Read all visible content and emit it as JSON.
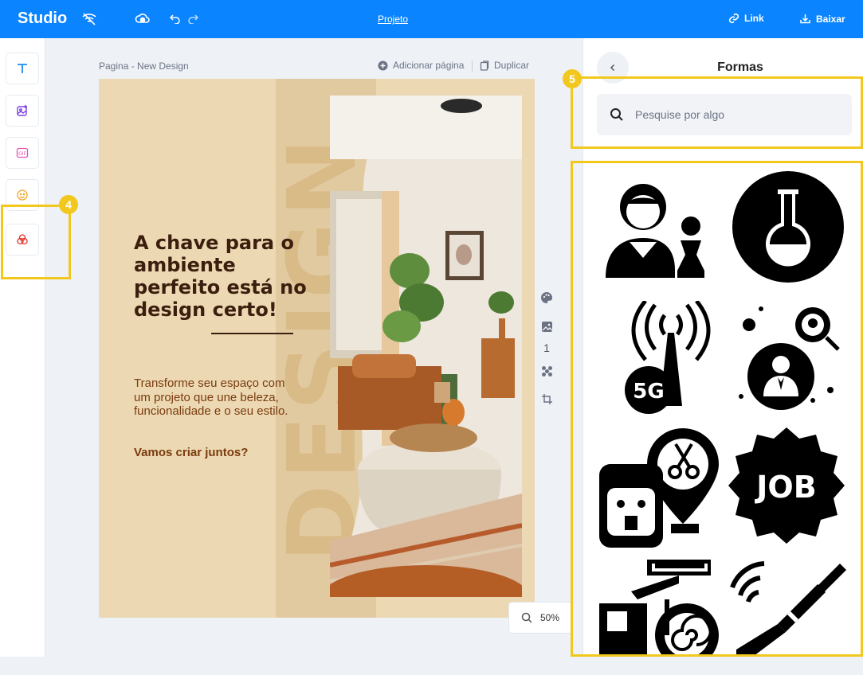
{
  "topbar": {
    "logo": "Studio",
    "project_title": "Projeto",
    "link_label": "Link",
    "download_label": "Baixar"
  },
  "sidebar": {
    "items": [
      {
        "icon": "text-icon"
      },
      {
        "icon": "image-add-icon"
      },
      {
        "icon": "gif-icon"
      },
      {
        "icon": "emoji-icon"
      },
      {
        "icon": "shapes-icon"
      }
    ]
  },
  "annotations": {
    "badge_4": "4",
    "badge_5": "5"
  },
  "page": {
    "label": "Pagina - New Design",
    "add_page": "Adicionar página",
    "duplicate": "Duplicar",
    "page_number": "1",
    "zoom": "50%"
  },
  "design": {
    "background_word": "DESIGN",
    "headline": "A chave para o ambiente perfeito está no design certo!",
    "subtext": "Transforme seu espaço com um projeto que une beleza, funcionalidade e o seu estilo.",
    "cta": "Vamos criar juntos?"
  },
  "panel": {
    "title": "Formas",
    "search_placeholder": "Pesquise por algo",
    "shapes": [
      {
        "icon": "chess-player-icon"
      },
      {
        "icon": "flask-icon"
      },
      {
        "icon": "5g-tower-icon"
      },
      {
        "icon": "location-person-icon"
      },
      {
        "icon": "barber-location-icon"
      },
      {
        "icon": "job-badge-icon",
        "text": "JOB"
      },
      {
        "icon": "construction-machine-icon"
      },
      {
        "icon": "cable-plug-icon"
      }
    ]
  },
  "colors": {
    "topbar": "#0a84ff",
    "highlight": "#f2c81e",
    "canvas_bg": "#ecd8b2",
    "headline": "#3b1e0e",
    "subtext": "#7a3b10"
  }
}
